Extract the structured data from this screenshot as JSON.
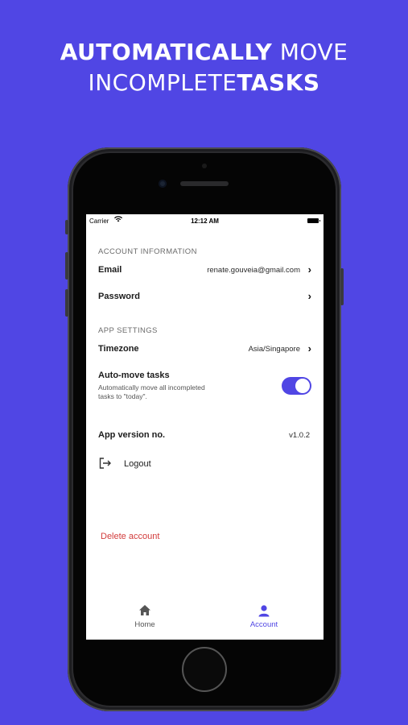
{
  "headline": {
    "line1_bold": "AUTOMATICALLY",
    "line1_regular": "MOVE",
    "line2_regular": "INCOMPLETE",
    "line2_bold": "TASKS"
  },
  "status_bar": {
    "carrier": "Carrier",
    "time": "12:12 AM"
  },
  "account_information": {
    "header": "ACCOUNT INFORMATION",
    "email_label": "Email",
    "email_value": "renate.gouveia@gmail.com",
    "password_label": "Password"
  },
  "app_settings": {
    "header": "APP SETTINGS",
    "timezone_label": "Timezone",
    "timezone_value": "Asia/Singapore",
    "automove_label": "Auto-move tasks",
    "automove_desc_1": "Automatically move all incompleted",
    "automove_desc_2": "tasks to \"today\".",
    "automove_enabled": true
  },
  "app_version": {
    "label": "App version no.",
    "value": "v1.0.2"
  },
  "actions": {
    "logout_label": "Logout",
    "delete_label": "Delete account"
  },
  "tabs": [
    {
      "label": "Home",
      "icon": "home-icon",
      "active": false
    },
    {
      "label": "Account",
      "icon": "user-icon",
      "active": true
    }
  ],
  "colors": {
    "brand": "#5046e4",
    "danger": "#d23c3c"
  }
}
